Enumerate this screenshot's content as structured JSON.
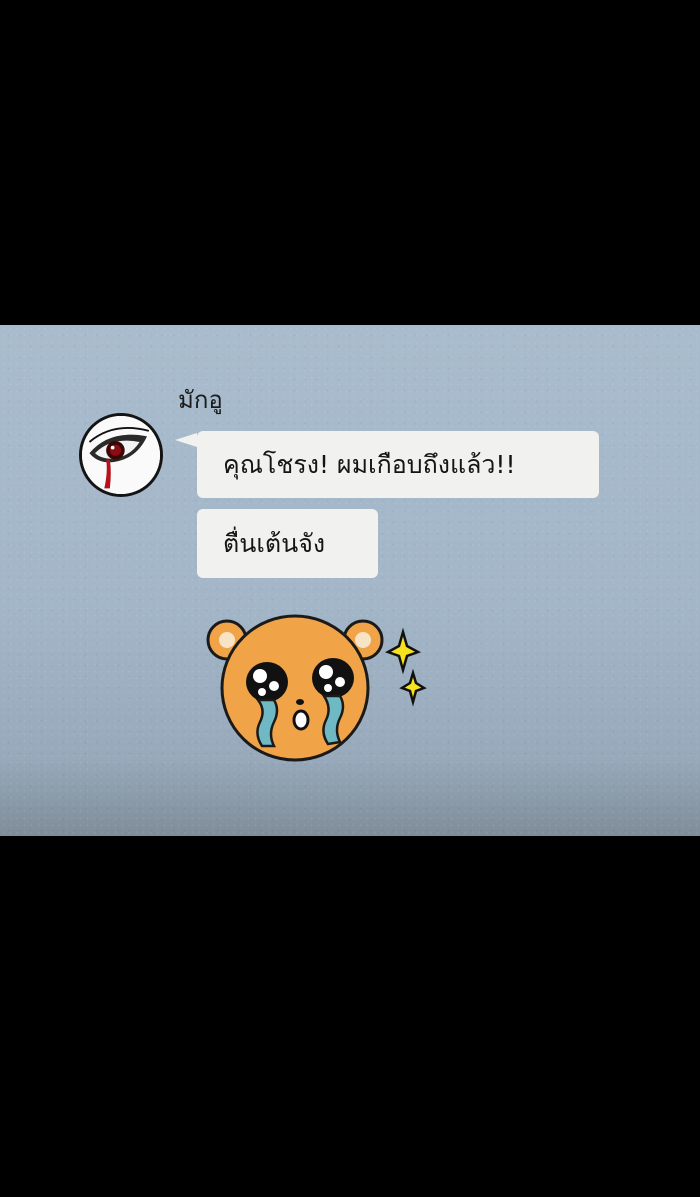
{
  "chat": {
    "sender_name": "มักอู",
    "messages": [
      {
        "text": "คุณโชรง! ผมเกือบถึงแล้ว!!"
      },
      {
        "text": "ตื่นเต้นจัง"
      }
    ],
    "sticker": {
      "icon": "crying-bear-sticker-icon"
    },
    "avatar": {
      "icon": "bleeding-eye-avatar-icon"
    }
  },
  "colors": {
    "panel": "#a9bccd",
    "bubble": "#f1f1ef",
    "bear": "#f1a348",
    "tears": "#6fb9c4",
    "sparkle": "#f6e21e"
  }
}
